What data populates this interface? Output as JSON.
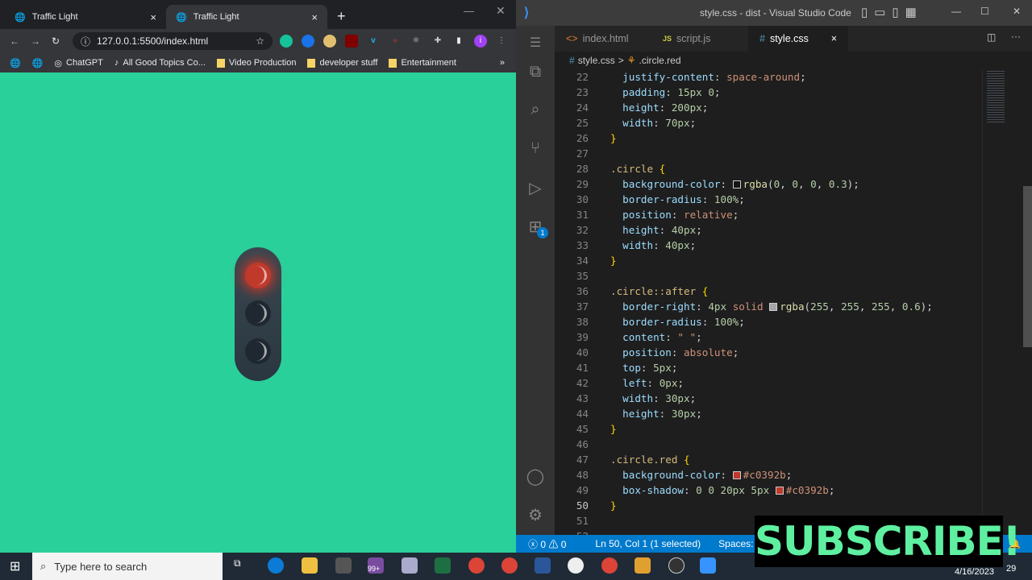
{
  "browser": {
    "tabs": [
      {
        "title": "Traffic Light",
        "close": "×"
      },
      {
        "title": "Traffic Light",
        "close": "×"
      }
    ],
    "new_tab": "+",
    "url": "127.0.0.1:5500/index.html",
    "profile_initial": "i",
    "bookmarks": [
      "ChatGPT",
      "All Good Topics Co...",
      "Video Production",
      "developer stuff",
      "Entertainment"
    ],
    "more_bookmarks": "»",
    "page": {
      "background": "#2ad09a",
      "active_light": "red",
      "light_color": "#c0392b"
    }
  },
  "vscode": {
    "title": "style.css - dist - Visual Studio Code",
    "tabs": [
      {
        "label": "index.html",
        "icon": "<>"
      },
      {
        "label": "script.js",
        "icon": "JS"
      },
      {
        "label": "style.css",
        "icon": "#",
        "close": "×"
      }
    ],
    "breadcrumb": {
      "file": "style.css",
      "separator": ">",
      "symbol": ".circle.red"
    },
    "extensions_badge": "1",
    "code": [
      {
        "n": "22",
        "t": [
          [
            "p",
            "  "
          ],
          [
            "prop",
            "justify-content"
          ],
          [
            "p",
            ": "
          ],
          [
            "val",
            "space-around"
          ],
          [
            "p",
            ";"
          ]
        ]
      },
      {
        "n": "23",
        "t": [
          [
            "p",
            "  "
          ],
          [
            "prop",
            "padding"
          ],
          [
            "p",
            ": "
          ],
          [
            "n",
            "15px 0"
          ],
          [
            "p",
            ";"
          ]
        ]
      },
      {
        "n": "24",
        "t": [
          [
            "p",
            "  "
          ],
          [
            "prop",
            "height"
          ],
          [
            "p",
            ": "
          ],
          [
            "n",
            "200px"
          ],
          [
            "p",
            ";"
          ]
        ]
      },
      {
        "n": "25",
        "t": [
          [
            "p",
            "  "
          ],
          [
            "prop",
            "width"
          ],
          [
            "p",
            ": "
          ],
          [
            "n",
            "70px"
          ],
          [
            "p",
            ";"
          ]
        ]
      },
      {
        "n": "26",
        "t": [
          [
            "br",
            "}"
          ]
        ]
      },
      {
        "n": "27",
        "t": []
      },
      {
        "n": "28",
        "t": [
          [
            "sel",
            ".circle"
          ],
          [
            "p",
            " "
          ],
          [
            "br",
            "{"
          ]
        ]
      },
      {
        "n": "29",
        "t": [
          [
            "p",
            "  "
          ],
          [
            "prop",
            "background-color"
          ],
          [
            "p",
            ": "
          ],
          [
            "sw",
            "rgba(0,0,0,0.3)"
          ],
          [
            "fn",
            "rgba"
          ],
          [
            "p",
            "("
          ],
          [
            "n",
            "0"
          ],
          [
            "p",
            ", "
          ],
          [
            "n",
            "0"
          ],
          [
            "p",
            ", "
          ],
          [
            "n",
            "0"
          ],
          [
            "p",
            ", "
          ],
          [
            "n",
            "0.3"
          ],
          [
            "p",
            ");"
          ]
        ]
      },
      {
        "n": "30",
        "t": [
          [
            "p",
            "  "
          ],
          [
            "prop",
            "border-radius"
          ],
          [
            "p",
            ": "
          ],
          [
            "n",
            "100%"
          ],
          [
            "p",
            ";"
          ]
        ]
      },
      {
        "n": "31",
        "t": [
          [
            "p",
            "  "
          ],
          [
            "prop",
            "position"
          ],
          [
            "p",
            ": "
          ],
          [
            "val",
            "relative"
          ],
          [
            "p",
            ";"
          ]
        ]
      },
      {
        "n": "32",
        "t": [
          [
            "p",
            "  "
          ],
          [
            "prop",
            "height"
          ],
          [
            "p",
            ": "
          ],
          [
            "n",
            "40px"
          ],
          [
            "p",
            ";"
          ]
        ]
      },
      {
        "n": "33",
        "t": [
          [
            "p",
            "  "
          ],
          [
            "prop",
            "width"
          ],
          [
            "p",
            ": "
          ],
          [
            "n",
            "40px"
          ],
          [
            "p",
            ";"
          ]
        ]
      },
      {
        "n": "34",
        "t": [
          [
            "br",
            "}"
          ]
        ]
      },
      {
        "n": "35",
        "t": []
      },
      {
        "n": "36",
        "t": [
          [
            "sel",
            ".circle::after"
          ],
          [
            "p",
            " "
          ],
          [
            "br",
            "{"
          ]
        ]
      },
      {
        "n": "37",
        "t": [
          [
            "p",
            "  "
          ],
          [
            "prop",
            "border-right"
          ],
          [
            "p",
            ": "
          ],
          [
            "n",
            "4px"
          ],
          [
            "p",
            " "
          ],
          [
            "val",
            "solid"
          ],
          [
            "p",
            " "
          ],
          [
            "sw",
            "rgba(255,255,255,0.6)"
          ],
          [
            "fn",
            "rgba"
          ],
          [
            "p",
            "("
          ],
          [
            "n",
            "255"
          ],
          [
            "p",
            ", "
          ],
          [
            "n",
            "255"
          ],
          [
            "p",
            ", "
          ],
          [
            "n",
            "255"
          ],
          [
            "p",
            ", "
          ],
          [
            "n",
            "0.6"
          ],
          [
            "p",
            ");"
          ]
        ]
      },
      {
        "n": "38",
        "t": [
          [
            "p",
            "  "
          ],
          [
            "prop",
            "border-radius"
          ],
          [
            "p",
            ": "
          ],
          [
            "n",
            "100%"
          ],
          [
            "p",
            ";"
          ]
        ]
      },
      {
        "n": "39",
        "t": [
          [
            "p",
            "  "
          ],
          [
            "prop",
            "content"
          ],
          [
            "p",
            ": "
          ],
          [
            "val",
            "\" \""
          ],
          [
            "p",
            ";"
          ]
        ]
      },
      {
        "n": "40",
        "t": [
          [
            "p",
            "  "
          ],
          [
            "prop",
            "position"
          ],
          [
            "p",
            ": "
          ],
          [
            "val",
            "absolute"
          ],
          [
            "p",
            ";"
          ]
        ]
      },
      {
        "n": "41",
        "t": [
          [
            "p",
            "  "
          ],
          [
            "prop",
            "top"
          ],
          [
            "p",
            ": "
          ],
          [
            "n",
            "5px"
          ],
          [
            "p",
            ";"
          ]
        ]
      },
      {
        "n": "42",
        "t": [
          [
            "p",
            "  "
          ],
          [
            "prop",
            "left"
          ],
          [
            "p",
            ": "
          ],
          [
            "n",
            "0px"
          ],
          [
            "p",
            ";"
          ]
        ]
      },
      {
        "n": "43",
        "t": [
          [
            "p",
            "  "
          ],
          [
            "prop",
            "width"
          ],
          [
            "p",
            ": "
          ],
          [
            "n",
            "30px"
          ],
          [
            "p",
            ";"
          ]
        ]
      },
      {
        "n": "44",
        "t": [
          [
            "p",
            "  "
          ],
          [
            "prop",
            "height"
          ],
          [
            "p",
            ": "
          ],
          [
            "n",
            "30px"
          ],
          [
            "p",
            ";"
          ]
        ]
      },
      {
        "n": "45",
        "t": [
          [
            "br",
            "}"
          ]
        ]
      },
      {
        "n": "46",
        "t": []
      },
      {
        "n": "47",
        "t": [
          [
            "sel",
            ".circle.red"
          ],
          [
            "p",
            " "
          ],
          [
            "br",
            "{"
          ]
        ]
      },
      {
        "n": "48",
        "t": [
          [
            "p",
            "  "
          ],
          [
            "prop",
            "background-color"
          ],
          [
            "p",
            ": "
          ],
          [
            "sw",
            "#c0392b"
          ],
          [
            "val",
            "#c0392b"
          ],
          [
            "p",
            ";"
          ]
        ]
      },
      {
        "n": "49",
        "t": [
          [
            "p",
            "  "
          ],
          [
            "prop",
            "box-shadow"
          ],
          [
            "p",
            ": "
          ],
          [
            "n",
            "0 0 20px 5px"
          ],
          [
            "p",
            " "
          ],
          [
            "sw",
            "#c0392b"
          ],
          [
            "val",
            "#c0392b"
          ],
          [
            "p",
            ";"
          ]
        ]
      },
      {
        "n": "50",
        "t": [
          [
            "br",
            "}"
          ]
        ]
      },
      {
        "n": "51",
        "t": []
      },
      {
        "n": "52",
        "t": []
      }
    ],
    "current_line": "50",
    "status": {
      "errors": "0",
      "warnings": "0",
      "position": "Ln 50, Col 1 (1 selected)",
      "spaces": "Spaces: 2"
    }
  },
  "overlay": {
    "subscribe": "SUBSCRIBE!"
  },
  "taskbar": {
    "search_placeholder": "Type here to search",
    "date": "4/16/2023",
    "notification_count": "29",
    "badge": "99+"
  }
}
